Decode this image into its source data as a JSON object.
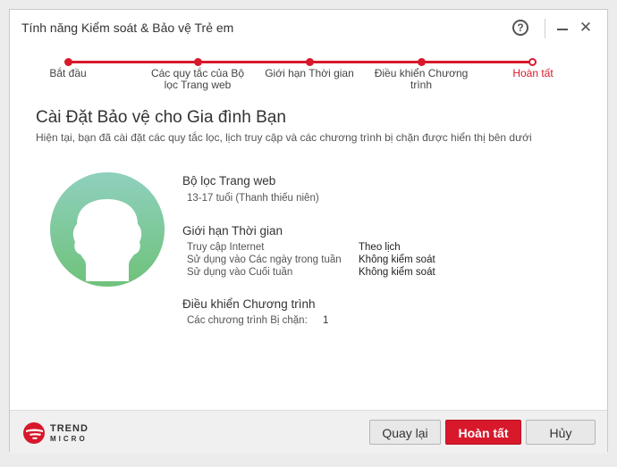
{
  "window": {
    "title": "Tính năng Kiểm soát & Bảo vệ Trẻ em",
    "help_symbol": "?",
    "close_symbol": "✕"
  },
  "steps": [
    {
      "label": "Bắt đầu"
    },
    {
      "label": "Các quy tắc của Bộ lọc Trang web"
    },
    {
      "label": "Giới hạn Thời gian"
    },
    {
      "label": "Điều khiển Chương trình"
    },
    {
      "label": "Hoàn tất"
    }
  ],
  "accent_color": "#d7192b",
  "main": {
    "heading": "Cài Đặt Bảo vệ cho Gia đình Bạn",
    "subheading": "Hiện tại, bạn đã cài đặt các quy tắc lọc, lịch truy cập và các chương trình bị chặn được hiển thị bên dưới",
    "web_filter": {
      "title": "Bộ lọc Trang web",
      "value": "13-17 tuổi (Thanh thiếu niên)"
    },
    "time_limits": {
      "title": "Giới hạn Thời gian",
      "rows": [
        {
          "label": "Truy cập Internet",
          "value": "Theo lịch"
        },
        {
          "label": "Sử dụng vào Các ngày trong tuần",
          "value": "Không kiểm soát"
        },
        {
          "label": "Sử dụng vào Cuối tuần",
          "value": "Không kiểm soát"
        }
      ]
    },
    "program_control": {
      "title": "Điều khiển Chương trình",
      "label": "Các chương trình Bị chặn:",
      "value": "1"
    }
  },
  "footer": {
    "logo_line1": "TREND",
    "logo_line2": "MICRO",
    "back_label": "Quay lại",
    "finish_label": "Hoàn tất",
    "cancel_label": "Hủy"
  }
}
